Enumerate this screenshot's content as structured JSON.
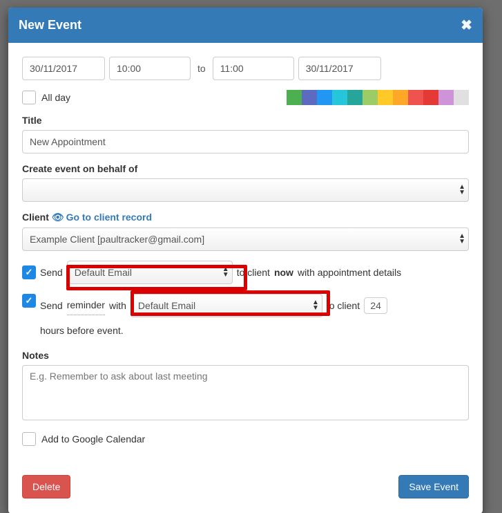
{
  "header": {
    "title": "New Event"
  },
  "datetime": {
    "start_date": "30/11/2017",
    "start_time": "10:00",
    "to_label": "to",
    "end_time": "11:00",
    "end_date": "30/11/2017"
  },
  "allday": {
    "label": "All day",
    "checked": false
  },
  "colors": [
    "#4caf50",
    "#5c6bc0",
    "#2196f3",
    "#26c6da",
    "#26a69a",
    "#9ccc65",
    "#ffca28",
    "#ffa726",
    "#ef5350",
    "#e53935",
    "#ce93d8",
    "#e0e0e0"
  ],
  "title_field": {
    "label": "Title",
    "value": "New Appointment"
  },
  "behalf": {
    "label": "Create event on behalf of",
    "value": ""
  },
  "client": {
    "label": "Client",
    "link_text": "Go to client record",
    "value": "Example Client [paultracker@gmail.com]"
  },
  "send_now": {
    "checked": true,
    "pre": "Send",
    "template": "Default Email",
    "mid": "to client",
    "now_word": "now",
    "post": "with appointment details"
  },
  "reminder": {
    "checked": true,
    "pre": "Send",
    "reminder_word": "reminder",
    "with_word": "with",
    "template": "Default Email",
    "to_client": "to client",
    "hours": "24",
    "hours_after": "hours before event."
  },
  "notes": {
    "label": "Notes",
    "placeholder": "E.g. Remember to ask about last meeting"
  },
  "google": {
    "label": "Add to Google Calendar",
    "checked": false
  },
  "footer": {
    "delete": "Delete",
    "save": "Save Event"
  }
}
